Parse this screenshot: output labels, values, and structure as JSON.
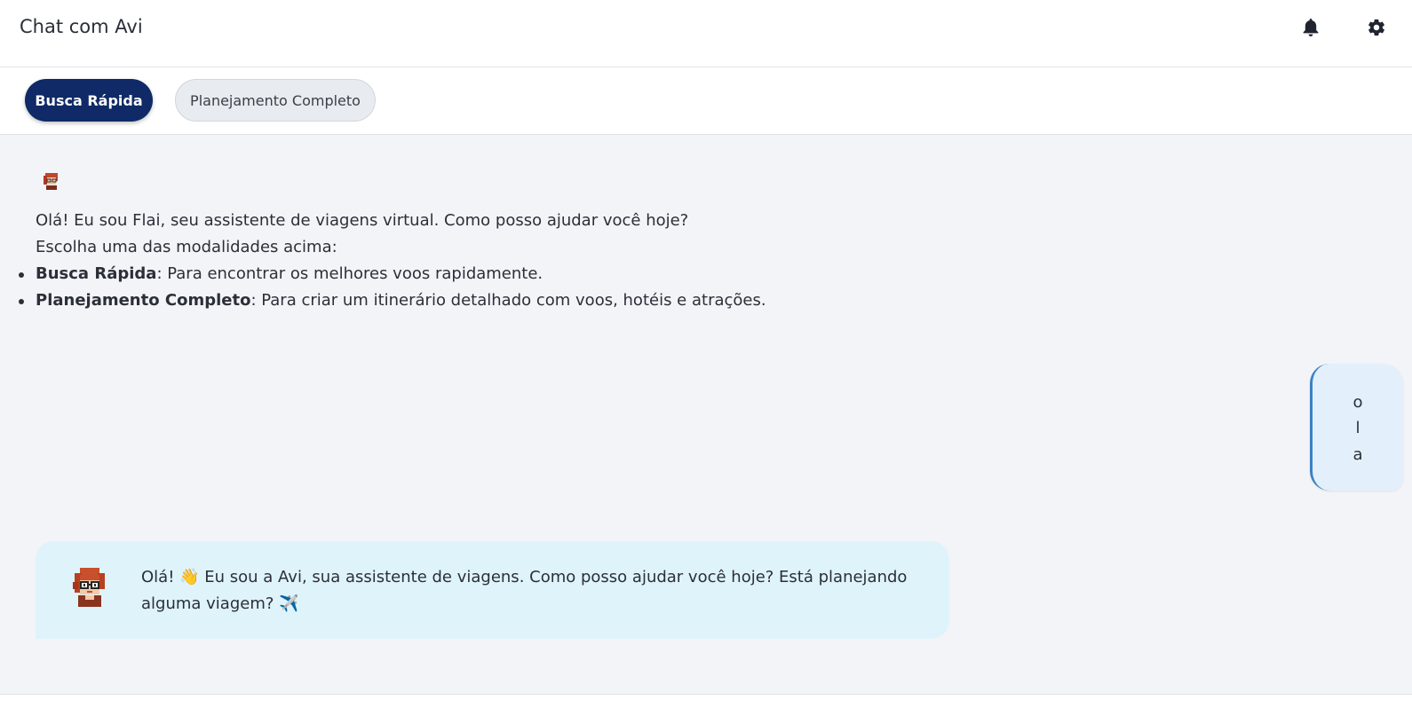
{
  "header": {
    "title": "Chat com Avi",
    "icons": [
      "bell-icon",
      "gear-icon"
    ]
  },
  "modes": {
    "quick_label": "Busca Rápida",
    "full_label": "Planejamento Completo",
    "active": "quick"
  },
  "welcome": {
    "line1": "Olá! Eu sou Flai, seu assistente de viagens virtual. Como posso ajudar você hoje?",
    "line2": "Escolha uma das modalidades acima:",
    "items": [
      {
        "bold": "Busca Rápida",
        "text": ": Para encontrar os melhores voos rapidamente."
      },
      {
        "bold": "Planejamento Completo",
        "text": ": Para criar um itinerário detalhado com voos, hotéis e atrações."
      }
    ]
  },
  "user_message": {
    "chars": [
      "o",
      "l",
      "a"
    ]
  },
  "bot_message": {
    "text": "Olá! 👋 Eu sou a Avi, sua assistente de viagens. Como posso ajudar você hoje? Está planejando alguma viagem? ✈️"
  },
  "colors": {
    "primary": "#0f2a66",
    "bot_bubble": "#dff3fb",
    "user_bubble": "#e3f0fc",
    "user_accent": "#3b82c4",
    "background": "#f3f4f8"
  }
}
